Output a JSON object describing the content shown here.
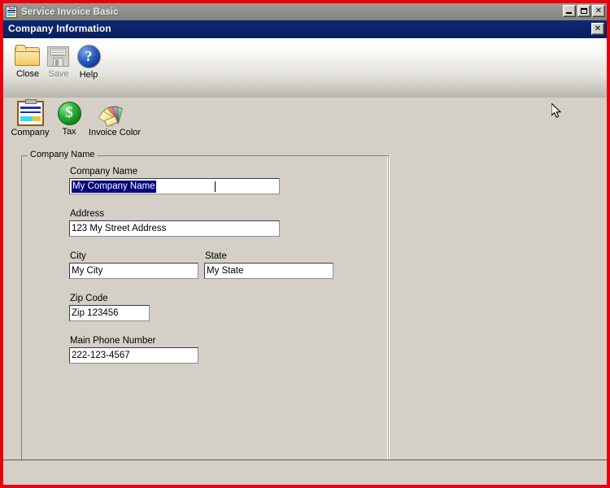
{
  "window": {
    "title": "Service Invoice Basic",
    "icon": "clipboard-icon",
    "controls": {
      "minimize_label": "_",
      "maximize_label": "",
      "close_label": "✕"
    }
  },
  "child_window": {
    "title": "Company Information",
    "close_label": "✕"
  },
  "toolbar": {
    "row1": [
      {
        "label": "Close",
        "icon": "folder-open-icon",
        "enabled": true
      },
      {
        "label": "Save",
        "icon": "floppy-disk-icon",
        "enabled": false
      },
      {
        "label": "Help",
        "icon": "help-question-icon",
        "enabled": true
      }
    ],
    "row2": [
      {
        "label": "Company",
        "icon": "clipboard-icon",
        "enabled": true
      },
      {
        "label": "Tax",
        "icon": "dollar-coin-icon",
        "enabled": true
      },
      {
        "label": "Invoice Color",
        "icon": "color-fan-icon",
        "enabled": true
      }
    ]
  },
  "form": {
    "groupbox_legend": "Company Name",
    "fields": {
      "company_name": {
        "label": "Company Name",
        "value": "My Company Name",
        "placeholder": "Company Name",
        "selected": true
      },
      "address": {
        "label": "Address",
        "value": "123 My Street Address",
        "placeholder": "Address",
        "selected": false
      },
      "city": {
        "label": "City",
        "value": "My City",
        "placeholder": "City",
        "selected": false
      },
      "state": {
        "label": "State",
        "value": "My State",
        "placeholder": "State",
        "selected": false
      },
      "zip_code": {
        "label": "Zip Code",
        "value": "Zip 123456",
        "placeholder": "Zip Code",
        "selected": false
      },
      "main_phone_number": {
        "label": "Main Phone Number",
        "value": "222-123-4567",
        "placeholder": "Main Phone Number",
        "selected": false
      }
    }
  },
  "statusbar": {
    "text": ""
  },
  "colors": {
    "frame_red": "#e8000d",
    "titlebar_inactive": "#8e8e8a",
    "child_titlebar": "#0a2468",
    "dialog_face": "#d4d0c8",
    "selection_navy": "#00007e"
  }
}
